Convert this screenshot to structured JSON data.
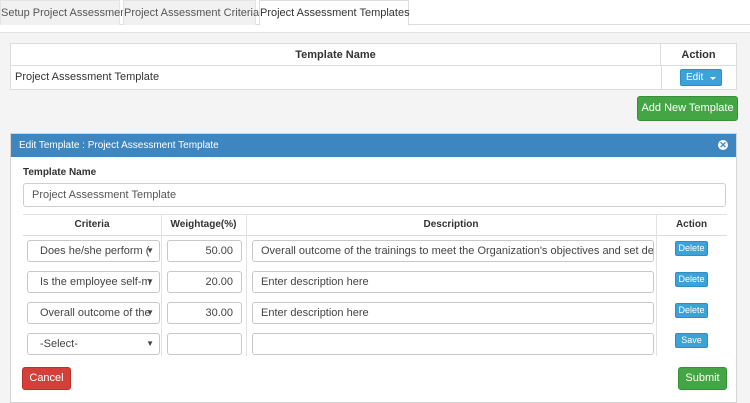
{
  "tabs": [
    {
      "label": "Setup Project Assessment"
    },
    {
      "label": "Project Assessment Criteria"
    },
    {
      "label": "Project Assessment Templates"
    }
  ],
  "templates_table": {
    "col_name": "Template Name",
    "col_action": "Action",
    "rows": [
      {
        "name": "Project Assessment Template",
        "action_label": "Edit"
      }
    ]
  },
  "add_new_label": "Add New Template",
  "edit_panel": {
    "title": "Edit Template :  Project Assessment Template",
    "close_icon": "close-circle-icon",
    "template_name_label": "Template Name",
    "template_name_value": "Project Assessment Template",
    "columns": {
      "criteria": "Criteria",
      "weightage": "Weightage(%)",
      "description": "Description",
      "action": "Action"
    },
    "rows": [
      {
        "criteria": "Does he/she perform (",
        "weightage": "50.00",
        "description": "Overall outcome of the trainings to meet the Organization's objectives and set  delivera",
        "action": "Delete"
      },
      {
        "criteria": "Is the employee self-m",
        "weightage": "20.00",
        "description": "Enter description here",
        "action": "Delete"
      },
      {
        "criteria": "Overall outcome of the",
        "weightage": "30.00",
        "description": "Enter description here",
        "action": "Delete"
      },
      {
        "criteria": "-Select-",
        "weightage": "",
        "description": "",
        "action": "Save"
      }
    ],
    "cancel_label": "Cancel",
    "submit_label": "Submit"
  },
  "colors": {
    "header_blue": "#3e86c0",
    "btn_info": "#3ba3d8",
    "btn_success": "#43a543",
    "btn_danger": "#d43f3a"
  }
}
